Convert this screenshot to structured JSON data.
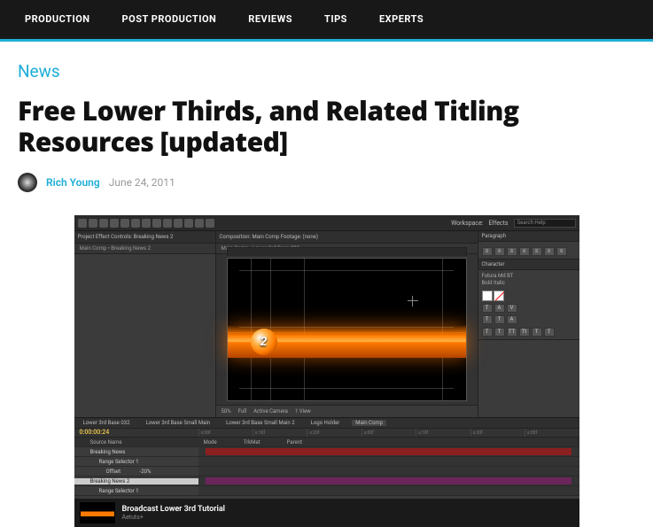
{
  "nav": {
    "items": [
      "PRODUCTION",
      "POST PRODUCTION",
      "REVIEWS",
      "TIPS",
      "EXPERTS"
    ]
  },
  "article": {
    "category": "News",
    "title": "Free Lower Thirds, and Related Titling Resources [updated]",
    "author": "Rich Young",
    "date": "June 24, 2011"
  },
  "ae": {
    "workspace_label": "Workspace:",
    "workspace_value": "Effects",
    "search_placeholder": "Search Help",
    "left_tabs": "Project   Effect Controls: Breaking News 2",
    "left_sub": "Main Comp • Breaking News 2",
    "center_tabs": "Composition: Main Comp   Footage: (none)",
    "center_sub": "Main Comp ‹ Lower 3rd Base 032",
    "viewer_controls": {
      "zoom": "50%",
      "res": "Full",
      "camera": "Active Camera",
      "view": "1 View"
    },
    "right": {
      "paragraph": "Paragraph",
      "character": "Character",
      "font": "Futura Md BT",
      "style": "Bold Italic"
    },
    "lt_badge": "2",
    "timeline": {
      "tabs": [
        "Lower 3rd Base 032",
        "Lower 3rd Base Small Main",
        "Lower 3rd Base Small Main 2",
        "Logo Holder",
        "Main Comp"
      ],
      "active_tab": 4,
      "timecode": "0:00:00:24",
      "columns": [
        "Source Name",
        "Mode",
        "TrkMat",
        "Parent"
      ],
      "marks": [
        "s:00f",
        "s:10f",
        "s:20f",
        "s:00f",
        "s:10f",
        "s:20f",
        "s:00f"
      ],
      "rows": [
        {
          "name": "Breaking News",
          "note": ""
        },
        {
          "name": "Range Selector 1",
          "note": ""
        },
        {
          "name": "Offset",
          "note": "-20%"
        },
        {
          "name": "Breaking News 2",
          "note": ""
        },
        {
          "name": "Range Selector 1",
          "note": ""
        }
      ]
    },
    "embed": {
      "title": "Broadcast Lower 3rd Tutorial",
      "by": "Aetuts+"
    }
  }
}
